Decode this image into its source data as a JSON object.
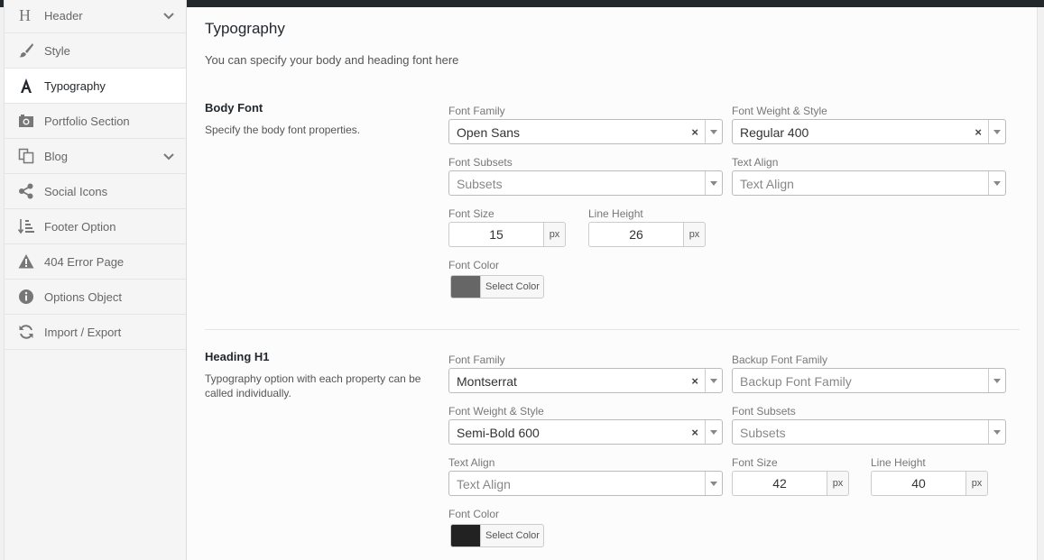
{
  "sidebar": {
    "items": [
      {
        "label": "Header",
        "icon": "header-h-icon",
        "expandable": true,
        "active": false
      },
      {
        "label": "Style",
        "icon": "paintbrush-icon",
        "expandable": false,
        "active": false
      },
      {
        "label": "Typography",
        "icon": "typography-a-icon",
        "expandable": false,
        "active": true
      },
      {
        "label": "Portfolio Section",
        "icon": "portfolio-camera-icon",
        "expandable": false,
        "active": false
      },
      {
        "label": "Blog",
        "icon": "blog-copy-icon",
        "expandable": true,
        "active": false
      },
      {
        "label": "Social Icons",
        "icon": "share-icon",
        "expandable": false,
        "active": false
      },
      {
        "label": "Footer Option",
        "icon": "sort-list-icon",
        "expandable": false,
        "active": false
      },
      {
        "label": "404 Error Page",
        "icon": "warning-icon",
        "expandable": false,
        "active": false
      },
      {
        "label": "Options Object",
        "icon": "info-icon",
        "expandable": false,
        "active": false
      },
      {
        "label": "Import / Export",
        "icon": "refresh-icon",
        "expandable": false,
        "active": false
      }
    ]
  },
  "main": {
    "title": "Typography",
    "subtitle": "You can specify your body and heading font here",
    "body_font": {
      "title": "Body Font",
      "desc": "Specify the body font properties.",
      "font_family": {
        "label": "Font Family",
        "value": "Open Sans"
      },
      "font_weight": {
        "label": "Font Weight & Style",
        "value": "Regular 400"
      },
      "font_subsets": {
        "label": "Font Subsets",
        "placeholder": "Subsets"
      },
      "text_align": {
        "label": "Text Align",
        "placeholder": "Text Align"
      },
      "font_size": {
        "label": "Font Size",
        "value": "15",
        "unit": "px"
      },
      "line_height": {
        "label": "Line Height",
        "value": "26",
        "unit": "px"
      },
      "font_color": {
        "label": "Font Color",
        "button": "Select Color",
        "color": "#666666"
      }
    },
    "heading_h1": {
      "title": "Heading H1",
      "desc": "Typography option with each property can be called individually.",
      "font_family": {
        "label": "Font Family",
        "value": "Montserrat"
      },
      "backup_font": {
        "label": "Backup Font Family",
        "placeholder": "Backup Font Family"
      },
      "font_weight": {
        "label": "Font Weight & Style",
        "value": "Semi-Bold 600"
      },
      "font_subsets": {
        "label": "Font Subsets",
        "placeholder": "Subsets"
      },
      "text_align": {
        "label": "Text Align",
        "placeholder": "Text Align"
      },
      "font_size": {
        "label": "Font Size",
        "value": "42",
        "unit": "px"
      },
      "line_height": {
        "label": "Line Height",
        "value": "40",
        "unit": "px"
      },
      "font_color": {
        "label": "Font Color",
        "button": "Select Color",
        "color": "#222222"
      }
    }
  }
}
